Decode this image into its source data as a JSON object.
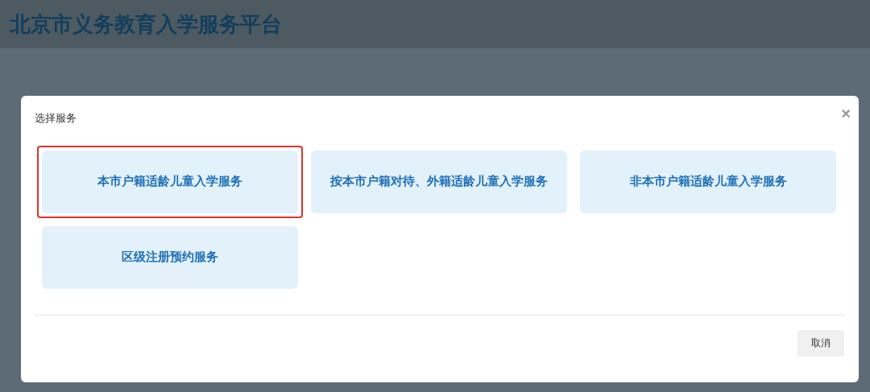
{
  "header": {
    "title": "北京市义务教育入学服务平台"
  },
  "dialog": {
    "title": "选择服务",
    "close": "×",
    "options": [
      {
        "label": "本市户籍适龄儿童入学服务",
        "selected": true
      },
      {
        "label": "按本市户籍对待、外籍适龄儿童入学服务",
        "selected": false
      },
      {
        "label": "非本市户籍适龄儿童入学服务",
        "selected": false
      },
      {
        "label": "区级注册预约服务",
        "selected": false
      }
    ],
    "cancel": "取消"
  }
}
